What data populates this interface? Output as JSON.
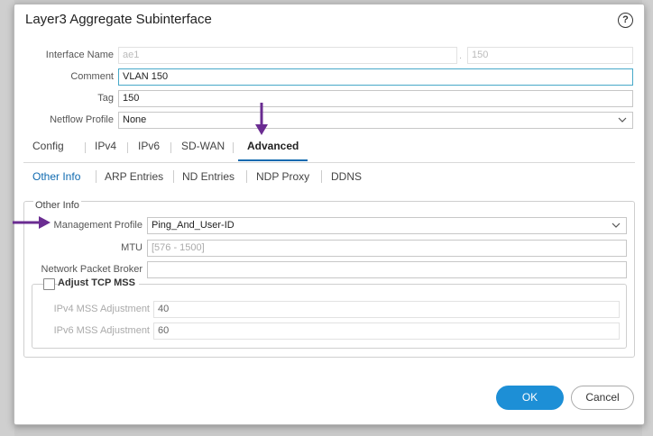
{
  "dialog": {
    "title": "Layer3 Aggregate Subinterface",
    "help_label": "?"
  },
  "form": {
    "interface_name_label": "Interface Name",
    "interface_name_value": "ae1",
    "interface_suffix_value": "150",
    "comment_label": "Comment",
    "comment_value": "VLAN 150",
    "tag_label": "Tag",
    "tag_value": "150",
    "netflow_label": "Netflow Profile",
    "netflow_value": "None"
  },
  "tabs": [
    {
      "label": "Config"
    },
    {
      "label": "IPv4"
    },
    {
      "label": "IPv6"
    },
    {
      "label": "SD-WAN"
    },
    {
      "label": "Advanced"
    }
  ],
  "subtabs": [
    {
      "label": "Other Info"
    },
    {
      "label": "ARP Entries"
    },
    {
      "label": "ND Entries"
    },
    {
      "label": "NDP Proxy"
    },
    {
      "label": "DDNS"
    }
  ],
  "other_info": {
    "title": "Other Info",
    "mgmt_label": "Management Profile",
    "mgmt_value": "Ping_And_User-ID",
    "mtu_label": "MTU",
    "mtu_placeholder": "[576 - 1500]",
    "npb_label": "Network Packet Broker",
    "npb_value": "",
    "adjust_tcp_label": "Adjust TCP MSS",
    "ipv4_mss_label": "IPv4 MSS Adjustment",
    "ipv4_mss_value": "40",
    "ipv6_mss_label": "IPv6 MSS Adjustment",
    "ipv6_mss_value": "60"
  },
  "buttons": {
    "ok": "OK",
    "cancel": "Cancel"
  },
  "colors": {
    "accent": "#0f6ab0",
    "ok_button": "#1d8fd6",
    "annotation_arrow": "#6a2c91"
  }
}
